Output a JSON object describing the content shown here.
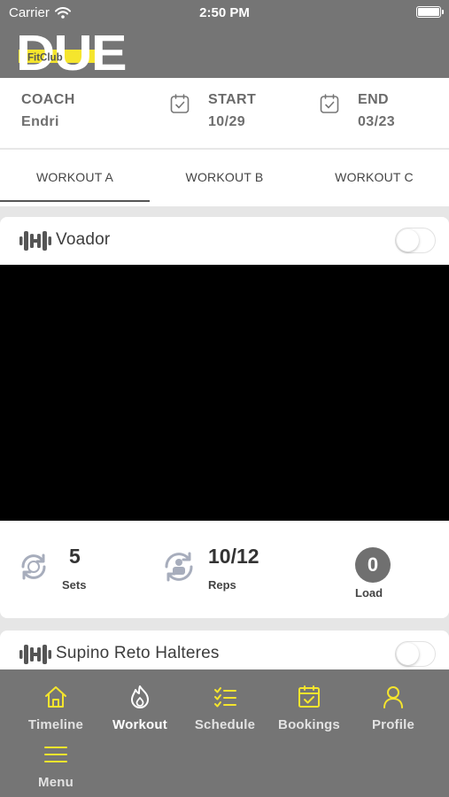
{
  "status_bar": {
    "carrier": "Carrier",
    "time": "2:50 PM"
  },
  "brand": {
    "logo_main": "DUE",
    "logo_sub": "FitClub",
    "accent": "#f5e52d"
  },
  "info": {
    "coach_label": "COACH",
    "coach_value": "Endri",
    "start_label": "START",
    "start_value": "10/29",
    "end_label": "END",
    "end_value": "03/23"
  },
  "tabs": [
    {
      "label": "WORKOUT A",
      "active": true
    },
    {
      "label": "WORKOUT B",
      "active": false
    },
    {
      "label": "WORKOUT C",
      "active": false
    }
  ],
  "exercises": [
    {
      "name": "Voador",
      "sets": "5",
      "sets_label": "Sets",
      "reps": "10/12",
      "reps_label": "Reps",
      "load": "0",
      "load_label": "Load",
      "done": false
    },
    {
      "name": "Supino Reto Halteres",
      "done": false
    }
  ],
  "bottom_nav": [
    {
      "label": "Timeline",
      "icon": "home-icon"
    },
    {
      "label": "Workout",
      "icon": "flame-icon",
      "active": true
    },
    {
      "label": "Schedule",
      "icon": "checklist-icon"
    },
    {
      "label": "Bookings",
      "icon": "calendar-check-icon"
    },
    {
      "label": "Profile",
      "icon": "person-icon"
    },
    {
      "label": "Menu",
      "icon": "menu-icon"
    }
  ]
}
